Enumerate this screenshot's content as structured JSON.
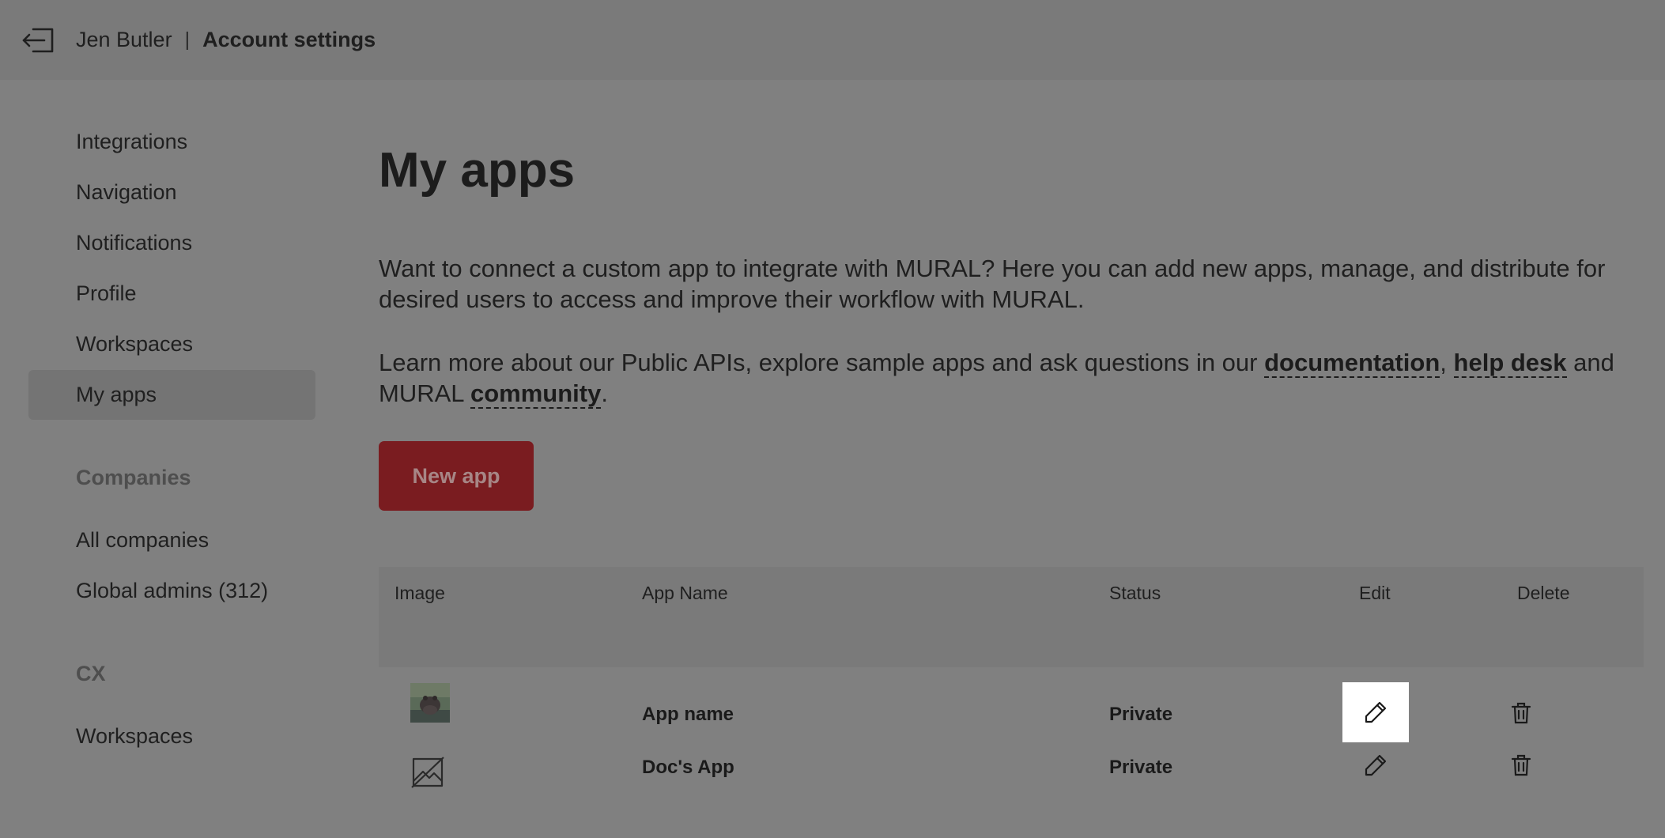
{
  "header": {
    "user_name": "Jen Butler",
    "separator": "|",
    "page_title": "Account settings"
  },
  "sidebar": {
    "items": [
      {
        "label": "Integrations"
      },
      {
        "label": "Navigation"
      },
      {
        "label": "Notifications"
      },
      {
        "label": "Profile"
      },
      {
        "label": "Workspaces"
      },
      {
        "label": "My apps",
        "active": true
      }
    ],
    "companies_heading": "Companies",
    "companies_items": [
      {
        "label": "All companies"
      },
      {
        "label": "Global admins (312)"
      }
    ],
    "cx_heading": "CX",
    "cx_items": [
      {
        "label": "Workspaces"
      }
    ]
  },
  "main": {
    "title": "My apps",
    "intro": "Want to connect a custom app to integrate with MURAL? Here you can add new apps, manage, and distribute for desired users to access and improve their workflow with MURAL.",
    "learn_prefix": "Learn more about our Public APIs, explore sample apps and ask questions in our ",
    "link_documentation": "documentation",
    "comma": ",",
    "link_helpdesk": "help desk",
    "learn_and": " and MURAL ",
    "link_community": "community",
    "period": ".",
    "new_app_label": "New app"
  },
  "table": {
    "headers": {
      "image": "Image",
      "app_name": "App Name",
      "status": "Status",
      "edit": "Edit",
      "delete": "Delete"
    },
    "rows": [
      {
        "image": "hippo-thumbnail",
        "name": "App name",
        "status": "Private"
      },
      {
        "image": "image-placeholder-icon",
        "name": "Doc's App",
        "status": "Private"
      }
    ]
  },
  "colors": {
    "overlay_bg": "#808080",
    "header_bg": "#7a7a7a",
    "primary_button": "#7a1c20",
    "edit_highlight": "#ffffff"
  }
}
